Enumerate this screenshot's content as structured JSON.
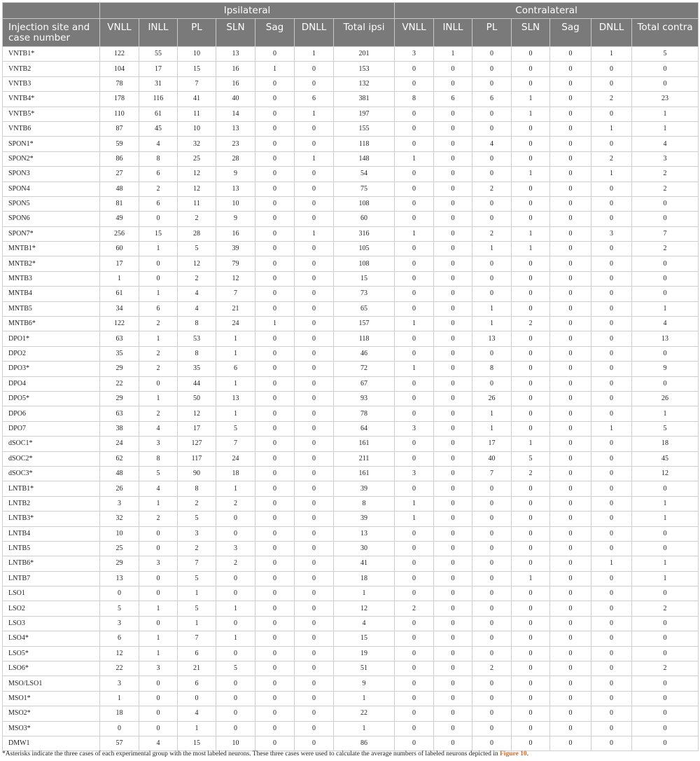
{
  "table": {
    "group_headers": {
      "ipsilateral": "Ipsilateral",
      "contralateral": "Contralateral"
    },
    "columns": [
      "Injection site and case number",
      "VNLL",
      "INLL",
      "PL",
      "SLN",
      "Sag",
      "DNLL",
      "Total ipsi",
      "VNLL",
      "INLL",
      "PL",
      "SLN",
      "Sag",
      "DNLL",
      "Total contra"
    ],
    "rows": [
      [
        "VNTB1*",
        "122",
        "55",
        "10",
        "13",
        "0",
        "1",
        "201",
        "3",
        "1",
        "0",
        "0",
        "0",
        "1",
        "5"
      ],
      [
        "VNTB2",
        "104",
        "17",
        "15",
        "16",
        "1",
        "0",
        "153",
        "0",
        "0",
        "0",
        "0",
        "0",
        "0",
        "0"
      ],
      [
        "VNTB3",
        "78",
        "31",
        "7",
        "16",
        "0",
        "0",
        "132",
        "0",
        "0",
        "0",
        "0",
        "0",
        "0",
        "0"
      ],
      [
        "VNTB4*",
        "178",
        "116",
        "41",
        "40",
        "0",
        "6",
        "381",
        "8",
        "6",
        "6",
        "1",
        "0",
        "2",
        "23"
      ],
      [
        "VNTB5*",
        "110",
        "61",
        "11",
        "14",
        "0",
        "1",
        "197",
        "0",
        "0",
        "0",
        "1",
        "0",
        "0",
        "1"
      ],
      [
        "VNTB6",
        "87",
        "45",
        "10",
        "13",
        "0",
        "0",
        "155",
        "0",
        "0",
        "0",
        "0",
        "0",
        "1",
        "1"
      ],
      [
        "SPON1*",
        "59",
        "4",
        "32",
        "23",
        "0",
        "0",
        "118",
        "0",
        "0",
        "4",
        "0",
        "0",
        "0",
        "4"
      ],
      [
        "SPON2*",
        "86",
        "8",
        "25",
        "28",
        "0",
        "1",
        "148",
        "1",
        "0",
        "0",
        "0",
        "0",
        "2",
        "3"
      ],
      [
        "SPON3",
        "27",
        "6",
        "12",
        "9",
        "0",
        "0",
        "54",
        "0",
        "0",
        "0",
        "1",
        "0",
        "1",
        "2"
      ],
      [
        "SPON4",
        "48",
        "2",
        "12",
        "13",
        "0",
        "0",
        "75",
        "0",
        "0",
        "2",
        "0",
        "0",
        "0",
        "2"
      ],
      [
        "SPON5",
        "81",
        "6",
        "11",
        "10",
        "0",
        "0",
        "108",
        "0",
        "0",
        "0",
        "0",
        "0",
        "0",
        "0"
      ],
      [
        "SPON6",
        "49",
        "0",
        "2",
        "9",
        "0",
        "0",
        "60",
        "0",
        "0",
        "0",
        "0",
        "0",
        "0",
        "0"
      ],
      [
        "SPON7*",
        "256",
        "15",
        "28",
        "16",
        "0",
        "1",
        "316",
        "1",
        "0",
        "2",
        "1",
        "0",
        "3",
        "7"
      ],
      [
        "MNTB1*",
        "60",
        "1",
        "5",
        "39",
        "0",
        "0",
        "105",
        "0",
        "0",
        "1",
        "1",
        "0",
        "0",
        "2"
      ],
      [
        "MNTB2*",
        "17",
        "0",
        "12",
        "79",
        "0",
        "0",
        "108",
        "0",
        "0",
        "0",
        "0",
        "0",
        "0",
        "0"
      ],
      [
        "MNTB3",
        "1",
        "0",
        "2",
        "12",
        "0",
        "0",
        "15",
        "0",
        "0",
        "0",
        "0",
        "0",
        "0",
        "0"
      ],
      [
        "MNTB4",
        "61",
        "1",
        "4",
        "7",
        "0",
        "0",
        "73",
        "0",
        "0",
        "0",
        "0",
        "0",
        "0",
        "0"
      ],
      [
        "MNTB5",
        "34",
        "6",
        "4",
        "21",
        "0",
        "0",
        "65",
        "0",
        "0",
        "1",
        "0",
        "0",
        "0",
        "1"
      ],
      [
        "MNTB6*",
        "122",
        "2",
        "8",
        "24",
        "1",
        "0",
        "157",
        "1",
        "0",
        "1",
        "2",
        "0",
        "0",
        "4"
      ],
      [
        "DPO1*",
        "63",
        "1",
        "53",
        "1",
        "0",
        "0",
        "118",
        "0",
        "0",
        "13",
        "0",
        "0",
        "0",
        "13"
      ],
      [
        "DPO2",
        "35",
        "2",
        "8",
        "1",
        "0",
        "0",
        "46",
        "0",
        "0",
        "0",
        "0",
        "0",
        "0",
        "0"
      ],
      [
        "DPO3*",
        "29",
        "2",
        "35",
        "6",
        "0",
        "0",
        "72",
        "1",
        "0",
        "8",
        "0",
        "0",
        "0",
        "9"
      ],
      [
        "DPO4",
        "22",
        "0",
        "44",
        "1",
        "0",
        "0",
        "67",
        "0",
        "0",
        "0",
        "0",
        "0",
        "0",
        "0"
      ],
      [
        "DPO5*",
        "29",
        "1",
        "50",
        "13",
        "0",
        "0",
        "93",
        "0",
        "0",
        "26",
        "0",
        "0",
        "0",
        "26"
      ],
      [
        "DPO6",
        "63",
        "2",
        "12",
        "1",
        "0",
        "0",
        "78",
        "0",
        "0",
        "1",
        "0",
        "0",
        "0",
        "1"
      ],
      [
        "DPO7",
        "38",
        "4",
        "17",
        "5",
        "0",
        "0",
        "64",
        "3",
        "0",
        "1",
        "0",
        "0",
        "1",
        "5"
      ],
      [
        "dSOC1*",
        "24",
        "3",
        "127",
        "7",
        "0",
        "0",
        "161",
        "0",
        "0",
        "17",
        "1",
        "0",
        "0",
        "18"
      ],
      [
        "dSOC2*",
        "62",
        "8",
        "117",
        "24",
        "0",
        "0",
        "211",
        "0",
        "0",
        "40",
        "5",
        "0",
        "0",
        "45"
      ],
      [
        "dSOC3*",
        "48",
        "5",
        "90",
        "18",
        "0",
        "0",
        "161",
        "3",
        "0",
        "7",
        "2",
        "0",
        "0",
        "12"
      ],
      [
        "LNTB1*",
        "26",
        "4",
        "8",
        "1",
        "0",
        "0",
        "39",
        "0",
        "0",
        "0",
        "0",
        "0",
        "0",
        "0"
      ],
      [
        "LNTB2",
        "3",
        "1",
        "2",
        "2",
        "0",
        "0",
        "8",
        "1",
        "0",
        "0",
        "0",
        "0",
        "0",
        "1"
      ],
      [
        "LNTB3*",
        "32",
        "2",
        "5",
        "0",
        "0",
        "0",
        "39",
        "1",
        "0",
        "0",
        "0",
        "0",
        "0",
        "1"
      ],
      [
        "LNTB4",
        "10",
        "0",
        "3",
        "0",
        "0",
        "0",
        "13",
        "0",
        "0",
        "0",
        "0",
        "0",
        "0",
        "0"
      ],
      [
        "LNTB5",
        "25",
        "0",
        "2",
        "3",
        "0",
        "0",
        "30",
        "0",
        "0",
        "0",
        "0",
        "0",
        "0",
        "0"
      ],
      [
        "LNTB6*",
        "29",
        "3",
        "7",
        "2",
        "0",
        "0",
        "41",
        "0",
        "0",
        "0",
        "0",
        "0",
        "1",
        "1"
      ],
      [
        "LNTB7",
        "13",
        "0",
        "5",
        "0",
        "0",
        "0",
        "18",
        "0",
        "0",
        "0",
        "1",
        "0",
        "0",
        "1"
      ],
      [
        "LSO1",
        "0",
        "0",
        "1",
        "0",
        "0",
        "0",
        "1",
        "0",
        "0",
        "0",
        "0",
        "0",
        "0",
        "0"
      ],
      [
        "LSO2",
        "5",
        "1",
        "5",
        "1",
        "0",
        "0",
        "12",
        "2",
        "0",
        "0",
        "0",
        "0",
        "0",
        "2"
      ],
      [
        "LSO3",
        "3",
        "0",
        "1",
        "0",
        "0",
        "0",
        "4",
        "0",
        "0",
        "0",
        "0",
        "0",
        "0",
        "0"
      ],
      [
        "LSO4*",
        "6",
        "1",
        "7",
        "1",
        "0",
        "0",
        "15",
        "0",
        "0",
        "0",
        "0",
        "0",
        "0",
        "0"
      ],
      [
        "LSO5*",
        "12",
        "1",
        "6",
        "0",
        "0",
        "0",
        "19",
        "0",
        "0",
        "0",
        "0",
        "0",
        "0",
        "0"
      ],
      [
        "LSO6*",
        "22",
        "3",
        "21",
        "5",
        "0",
        "0",
        "51",
        "0",
        "0",
        "2",
        "0",
        "0",
        "0",
        "2"
      ],
      [
        "MSO/LSO1",
        "3",
        "0",
        "6",
        "0",
        "0",
        "0",
        "9",
        "0",
        "0",
        "0",
        "0",
        "0",
        "0",
        "0"
      ],
      [
        "MSO1*",
        "1",
        "0",
        "0",
        "0",
        "0",
        "0",
        "1",
        "0",
        "0",
        "0",
        "0",
        "0",
        "0",
        "0"
      ],
      [
        "MSO2*",
        "18",
        "0",
        "4",
        "0",
        "0",
        "0",
        "22",
        "0",
        "0",
        "0",
        "0",
        "0",
        "0",
        "0"
      ],
      [
        "MSO3*",
        "0",
        "0",
        "1",
        "0",
        "0",
        "0",
        "1",
        "0",
        "0",
        "0",
        "0",
        "0",
        "0",
        "0"
      ],
      [
        "DMW1",
        "57",
        "4",
        "15",
        "10",
        "0",
        "0",
        "86",
        "0",
        "0",
        "0",
        "0",
        "0",
        "0",
        "0"
      ]
    ]
  },
  "footnote": {
    "text": "*Asterisks indicate the three cases of each experimental group with the most labeled neurons. These three cases were used to calculate the average numbers of labeled neurons depicted in ",
    "link": "Figure 10",
    "end": "."
  },
  "colors": {
    "header_bg": "#7a7a7a",
    "link": "#e2661b",
    "grid": "#cfcfcf"
  }
}
